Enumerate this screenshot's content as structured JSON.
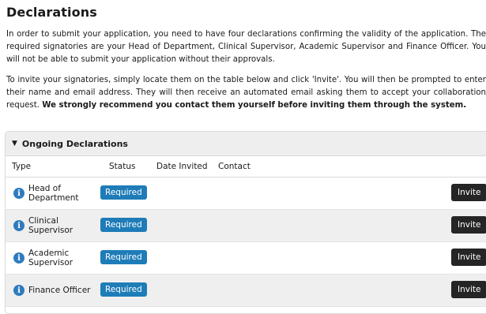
{
  "page": {
    "title": "Declarations",
    "intro": "In order to submit your application, you need to have four declarations confirming the validity of the application. The required signatories are your Head of Department, Clinical Supervisor, Academic Supervisor and Finance Officer. You will not be able to submit your application without their approvals.",
    "instructions": "To invite your signatories, simply locate them on the table below and click 'Invite'. You will then be prompted to enter their name and email address. They will then receive an automated email asking them to accept your collaboration request.",
    "instructions_bold": "We strongly recommend you contact them yourself before inviting them through the system."
  },
  "panel": {
    "title": "Ongoing Declarations",
    "columns": [
      "Type",
      "Status",
      "Date Invited",
      "Contact"
    ],
    "rows": [
      {
        "type": "Head of Department",
        "status": "Required",
        "date_invited": "",
        "contact": "",
        "action": "Invite"
      },
      {
        "type": "Clinical Supervisor",
        "status": "Required",
        "date_invited": "",
        "contact": "",
        "action": "Invite"
      },
      {
        "type": "Academic Supervisor",
        "status": "Required",
        "date_invited": "",
        "contact": "",
        "action": "Invite"
      },
      {
        "type": "Finance Officer",
        "status": "Required",
        "date_invited": "",
        "contact": "",
        "action": "Invite"
      }
    ]
  },
  "colors": {
    "required_badge": "#1e7cb8",
    "invite_button": "#252525",
    "info_icon": "#2f7bbd"
  },
  "icons": {
    "info": "info-icon",
    "collapse": "caret-down-icon"
  }
}
